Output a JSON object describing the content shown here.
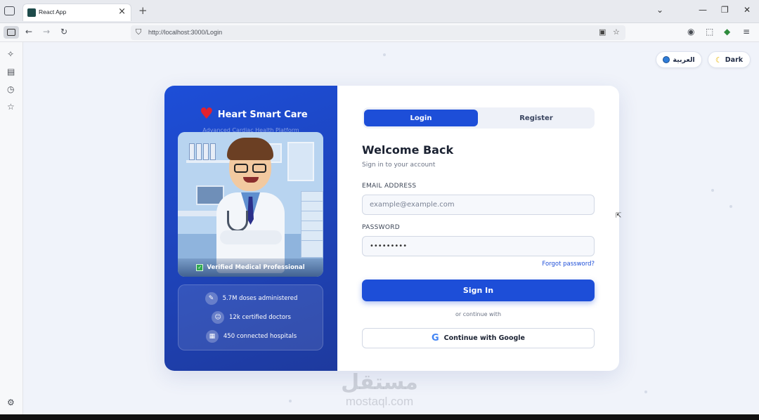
{
  "browser": {
    "tab_title": "React App",
    "url": "http://localhost:3000/Login"
  },
  "top_controls": {
    "language_label": "العربية",
    "theme_label": "Dark"
  },
  "brand": {
    "name": "Heart Smart Care",
    "tagline": "Advanced Cardiac Health Platform"
  },
  "illustration": {
    "verified_label": "Verified Medical Professional"
  },
  "stats": [
    {
      "icon": "syringe-icon",
      "label": "5.7M doses administered"
    },
    {
      "icon": "doctor-icon",
      "label": "12k certified doctors"
    },
    {
      "icon": "hospital-icon",
      "label": "450 connected hospitals"
    }
  ],
  "auth": {
    "tabs": {
      "login": "Login",
      "register": "Register"
    },
    "title": "Welcome Back",
    "subtitle": "Sign in to your account",
    "email_label": "EMAIL ADDRESS",
    "email_placeholder": "example@example.com",
    "password_label": "PASSWORD",
    "password_value": "•••••••••",
    "forgot": "Forgot password?",
    "signin": "Sign In",
    "divider": "or continue with",
    "google": "Continue with Google"
  },
  "watermark": {
    "arabic": "مستقل",
    "latin": "mostaql.com"
  },
  "colors": {
    "primary": "#1d4ed8",
    "panel_dark": "#1e3a9e",
    "heart": "#e3212f",
    "page_bg": "#f0f3fa"
  }
}
